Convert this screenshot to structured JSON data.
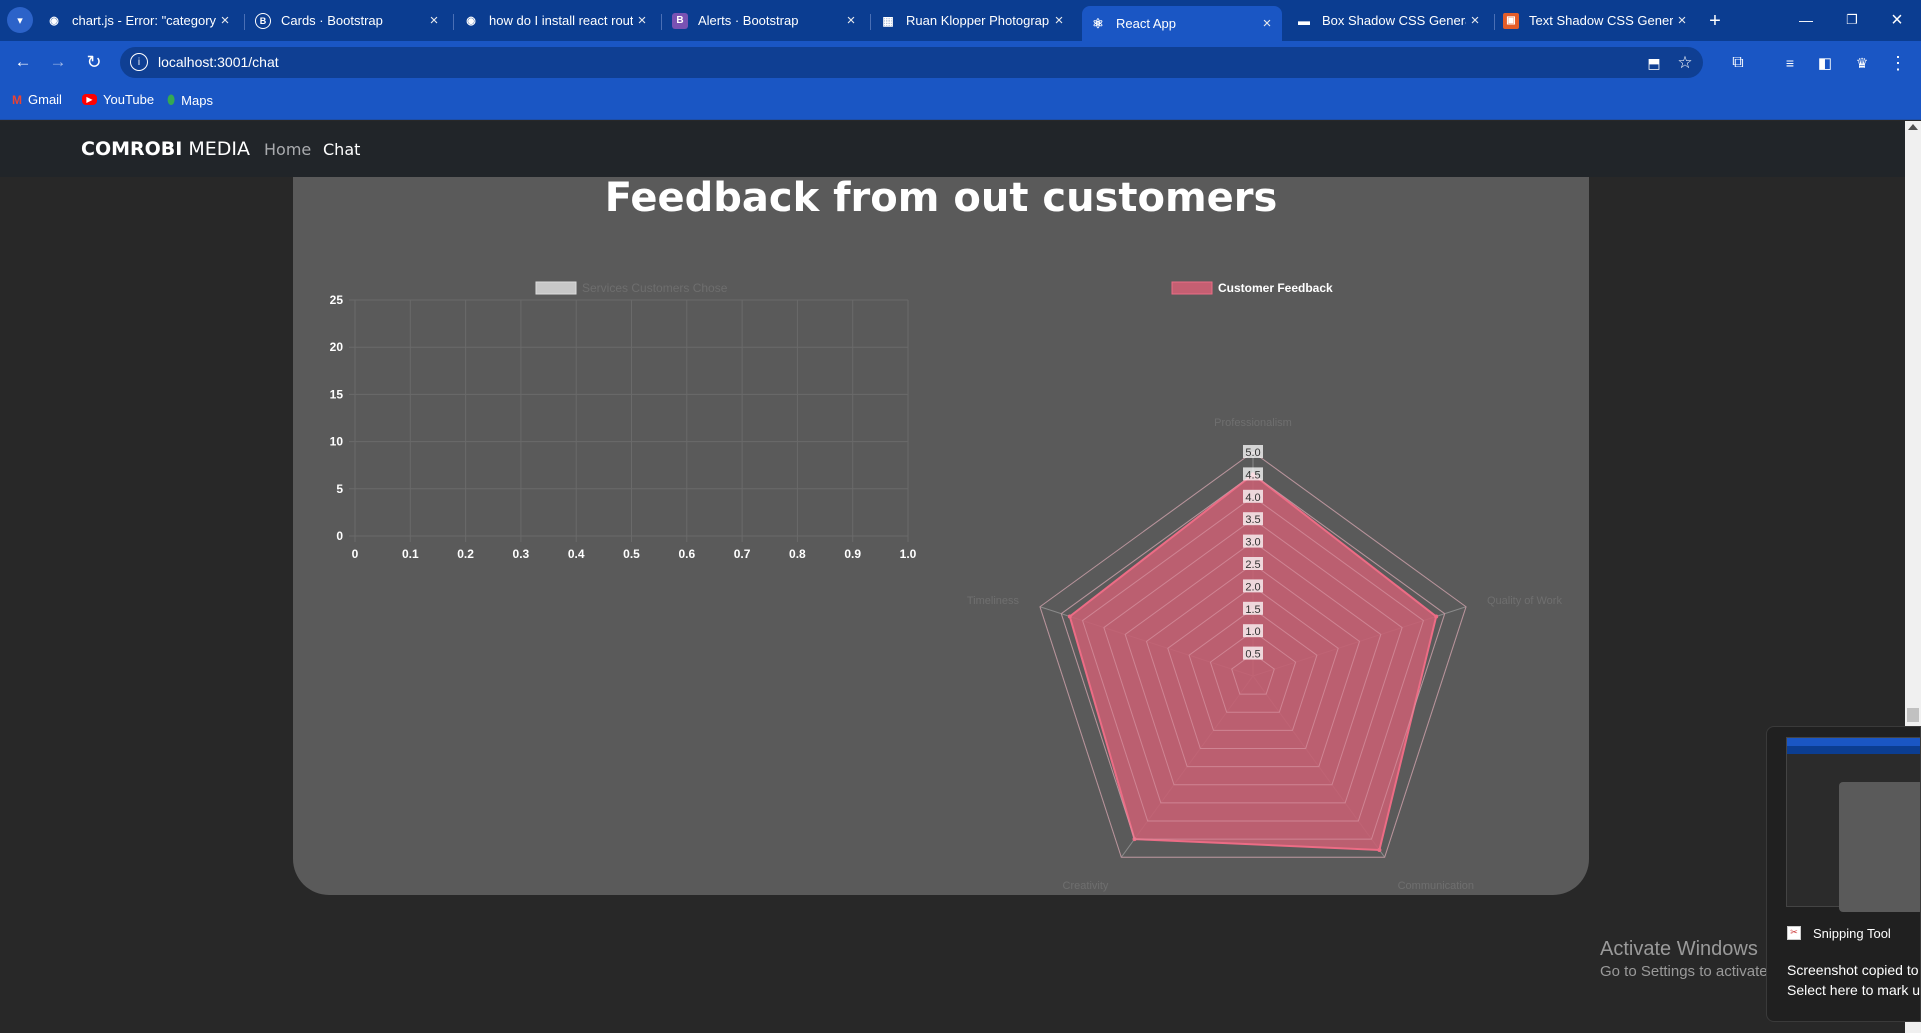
{
  "browser": {
    "tabs": [
      {
        "label": "chart.js - Error: \"category\"",
        "icon": "github-icon"
      },
      {
        "label": "Cards · Bootstrap",
        "icon": "bootstrap-icon"
      },
      {
        "label": "how do I install react rout",
        "icon": "github-icon"
      },
      {
        "label": "Alerts · Bootstrap",
        "icon": "bootstrap-icon"
      },
      {
        "label": "Ruan Klopper Photograph",
        "icon": "site-icon"
      },
      {
        "label": "React App",
        "icon": "react-icon",
        "active": true
      },
      {
        "label": "Box Shadow CSS Generat",
        "icon": "site-icon"
      },
      {
        "label": "Text Shadow CSS Generat",
        "icon": "site-icon"
      }
    ],
    "url": "localhost:3001/chat",
    "bookmarks": [
      "Gmail",
      "YouTube",
      "Maps"
    ]
  },
  "navbar": {
    "brand_bold": "COMROBI",
    "brand_rest": " MEDIA",
    "links": [
      "Home",
      "Chat"
    ]
  },
  "page": {
    "heading": "Feedback from out customers"
  },
  "colors": {
    "navbar_bg": "#212529",
    "card_bg": "#5a5a5a",
    "radar_fill": "#c55f72",
    "radar_stroke": "#ec6c85",
    "line_legend_box": "#c8c8c8"
  },
  "chart_data": [
    {
      "type": "line",
      "legend": "Services Customers Chose",
      "legend_position": "top",
      "x": [
        0,
        0.1,
        0.2,
        0.3,
        0.4,
        0.5,
        0.6,
        0.7,
        0.8,
        0.9,
        1.0
      ],
      "x_tick_labels": [
        "0",
        "0.1",
        "0.2",
        "0.3",
        "0.4",
        "0.5",
        "0.6",
        "0.7",
        "0.8",
        "0.9",
        "1.0"
      ],
      "y_tick_labels": [
        "0",
        "5",
        "10",
        "15",
        "20",
        "25"
      ],
      "xlim": [
        0,
        1
      ],
      "ylim": [
        0,
        25
      ],
      "series": [],
      "grid": true
    },
    {
      "type": "radar",
      "legend": "Customer Feedback",
      "legend_position": "top",
      "categories": [
        "Professionalism",
        "Quality of Work",
        "Communication",
        "Creativity",
        "Timeliness"
      ],
      "values": [
        4.5,
        4.3,
        4.8,
        4.5,
        4.3
      ],
      "r_ticks": [
        "0.5",
        "1.0",
        "1.5",
        "2.0",
        "2.5",
        "3.0",
        "3.5",
        "4.0",
        "4.5",
        "5.0"
      ],
      "rlim": [
        0,
        5
      ],
      "grid": true
    }
  ],
  "os": {
    "watermark_title": "Activate Windows",
    "watermark_sub": "Go to Settings to activate Windows.",
    "toast_app": "Snipping Tool",
    "toast_title": "Screenshot copied to clipboard",
    "toast_sub": "Select here to mark up and share."
  }
}
